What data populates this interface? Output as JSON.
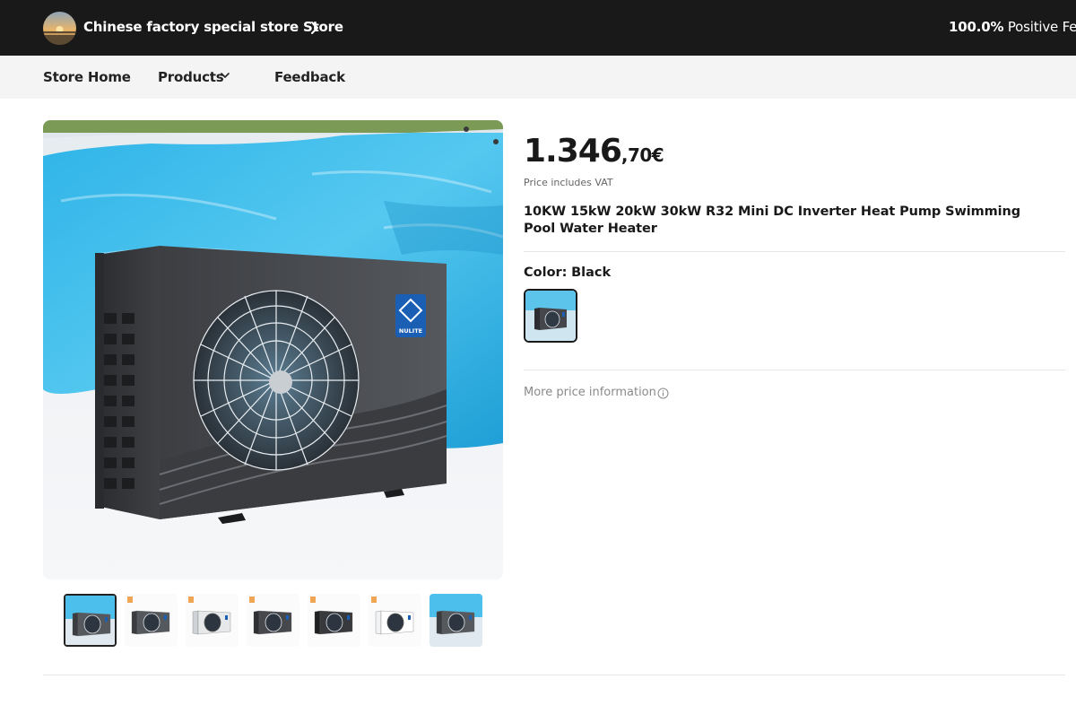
{
  "store": {
    "name": "Chinese factory special store Store",
    "feedback_percent": "100.0%",
    "feedback_label": "Positive Feedback"
  },
  "nav": {
    "home": "Store Home",
    "products": "Products",
    "feedback": "Feedback"
  },
  "product": {
    "price_integer": "1.346",
    "price_decimal": ",70€",
    "vat_note": "Price includes VAT",
    "title": "10KW 15kW 20kW 30kW R32 Mini DC Inverter Heat Pump Swimming Pool Water Heater",
    "color_label": "Color:",
    "color_value": "Black",
    "more_price": "More price information",
    "brand_badge": "NULITE"
  },
  "thumbnails": [
    {
      "name": "thumb-1",
      "unit": "dark-gray",
      "bg": "pool",
      "active": true
    },
    {
      "name": "thumb-2",
      "unit": "dark-gray",
      "bg": "plain",
      "badge": true
    },
    {
      "name": "thumb-3",
      "unit": "silver",
      "bg": "plain",
      "badge": true
    },
    {
      "name": "thumb-4",
      "unit": "charcoal",
      "bg": "plain",
      "badge": true
    },
    {
      "name": "thumb-5",
      "unit": "black",
      "bg": "plain",
      "badge": true
    },
    {
      "name": "thumb-6",
      "unit": "white",
      "bg": "plain",
      "badge": true
    },
    {
      "name": "thumb-7",
      "unit": "dark-gray",
      "bg": "pool"
    }
  ],
  "colors": {
    "top_bar": "#191919",
    "nav_bar": "#f4f4f4",
    "brand_blue": "#1a5fb4",
    "pool_blue": "#35b7e6"
  }
}
